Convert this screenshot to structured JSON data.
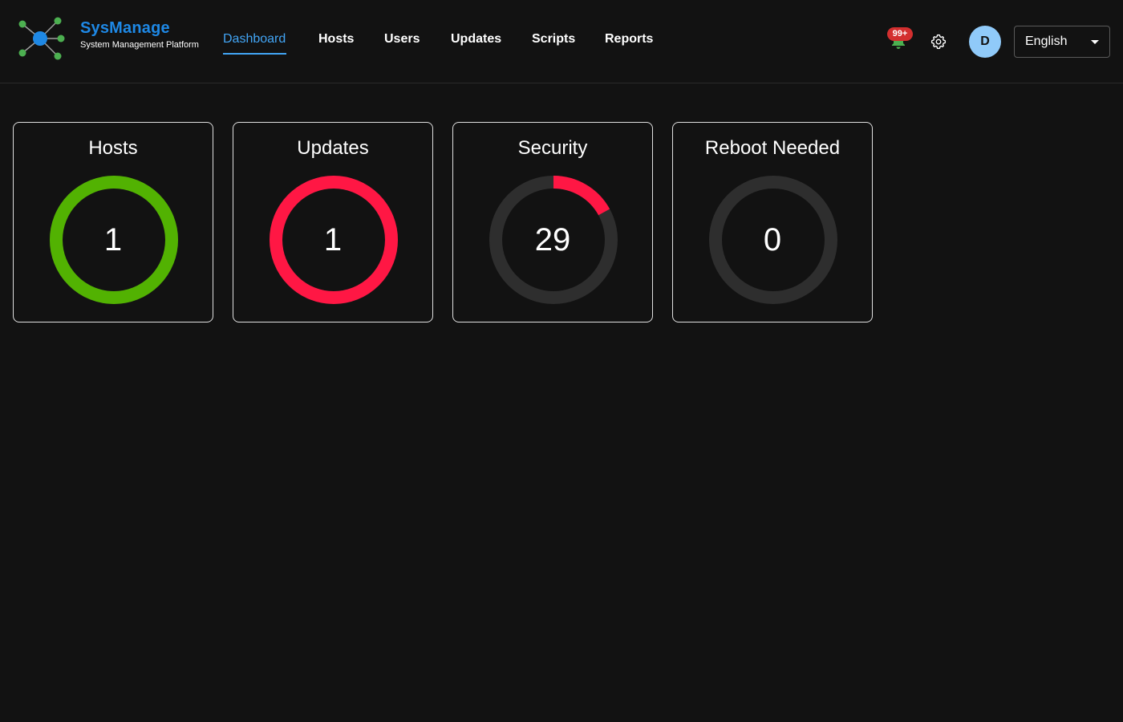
{
  "brand": {
    "name": "SysManage",
    "subtitle": "System Management Platform"
  },
  "nav": {
    "items": [
      {
        "label": "Dashboard",
        "active": true
      },
      {
        "label": "Hosts",
        "active": false
      },
      {
        "label": "Users",
        "active": false
      },
      {
        "label": "Updates",
        "active": false
      },
      {
        "label": "Scripts",
        "active": false
      },
      {
        "label": "Reports",
        "active": false
      }
    ]
  },
  "header": {
    "notification_icon": "bell-icon",
    "notification_badge": "99+",
    "settings_icon": "gear-icon",
    "avatar_initial": "D",
    "language": {
      "selected": "English"
    }
  },
  "cards": [
    {
      "title": "Hosts",
      "value": "1",
      "fraction": 1.0,
      "color": "#52b202"
    },
    {
      "title": "Updates",
      "value": "1",
      "fraction": 1.0,
      "color": "#ff1744"
    },
    {
      "title": "Security",
      "value": "29",
      "fraction": 0.17,
      "color": "#ff1744"
    },
    {
      "title": "Reboot Needed",
      "value": "0",
      "fraction": 0,
      "color": "#2e2e2e"
    }
  ],
  "colors": {
    "background": "#121212",
    "accent": "#42a5f5",
    "brand": "#1e88e5",
    "ring_track": "#2e2e2e",
    "success": "#52b202",
    "danger": "#ff1744",
    "node_green": "#4caf50"
  }
}
